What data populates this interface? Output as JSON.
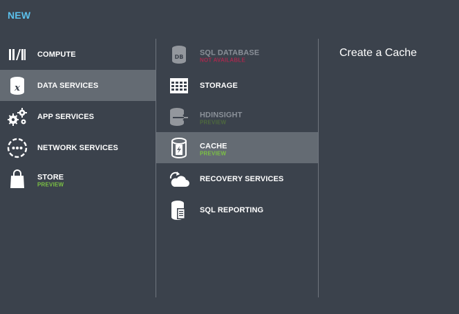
{
  "header": {
    "title": "NEW"
  },
  "categories": [
    {
      "label": "COMPUTE",
      "sub": "",
      "icon": "compute-icon"
    },
    {
      "label": "DATA SERVICES",
      "sub": "",
      "icon": "data-services-icon"
    },
    {
      "label": "APP SERVICES",
      "sub": "",
      "icon": "gears-icon"
    },
    {
      "label": "NETWORK SERVICES",
      "sub": "",
      "icon": "network-icon"
    },
    {
      "label": "STORE",
      "sub": "PREVIEW",
      "icon": "shopping-bag-icon"
    }
  ],
  "services": [
    {
      "label": "SQL DATABASE",
      "sub": "NOT AVAILABLE",
      "icon": "database-icon"
    },
    {
      "label": "STORAGE",
      "sub": "",
      "icon": "storage-grid-icon"
    },
    {
      "label": "HDINSIGHT",
      "sub": "PREVIEW",
      "icon": "hdinsight-icon"
    },
    {
      "label": "CACHE",
      "sub": "PREVIEW",
      "icon": "cache-icon"
    },
    {
      "label": "RECOVERY SERVICES",
      "sub": "",
      "icon": "cloud-icon"
    },
    {
      "label": "SQL REPORTING",
      "sub": "",
      "icon": "report-icon"
    }
  ],
  "detail": {
    "title": "Create a Cache"
  },
  "colors": {
    "background": "#3b424c",
    "selected": "#646b73",
    "accent_blue": "#5bc0ec",
    "preview_green": "#7cc244",
    "not_available_red": "#a32a4e"
  }
}
